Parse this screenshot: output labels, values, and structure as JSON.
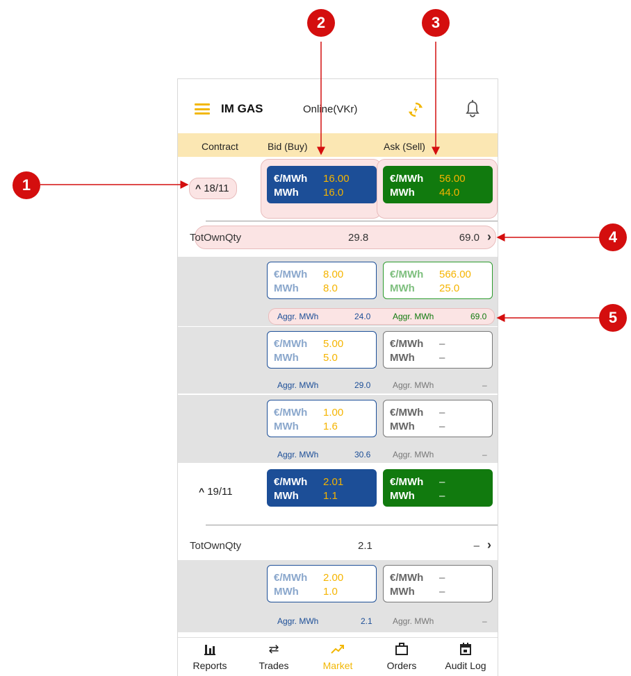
{
  "header": {
    "app_title": "IM GAS",
    "status": "Online(VKr)"
  },
  "columns": {
    "contract": "Contract",
    "bid": "Bid (Buy)",
    "ask": "Ask (Sell)"
  },
  "contracts": [
    {
      "date": "18/11",
      "best_bid": {
        "price_label": "€/MWh",
        "price": "16.00",
        "qty_label": "MWh",
        "qty": "16.0"
      },
      "best_ask": {
        "price_label": "€/MWh",
        "price": "56.00",
        "qty_label": "MWh",
        "qty": "44.0"
      },
      "tot": {
        "label": "TotOwnQty",
        "bid": "29.8",
        "ask": "69.0"
      },
      "depth": [
        {
          "bid": {
            "price_label": "€/MWh",
            "price": "8.00",
            "qty_label": "MWh",
            "qty": "8.0"
          },
          "ask": {
            "price_label": "€/MWh",
            "price": "566.00",
            "qty_label": "MWh",
            "qty": "25.0"
          },
          "aggr_label": "Aggr. MWh",
          "aggr_bid": "24.0",
          "aggr_ask": "69.0"
        },
        {
          "bid": {
            "price_label": "€/MWh",
            "price": "5.00",
            "qty_label": "MWh",
            "qty": "5.0"
          },
          "ask": {
            "price_label": "€/MWh",
            "price": "–",
            "qty_label": "MWh",
            "qty": "–"
          },
          "aggr_label": "Aggr. MWh",
          "aggr_bid": "29.0",
          "aggr_ask": "–"
        },
        {
          "bid": {
            "price_label": "€/MWh",
            "price": "1.00",
            "qty_label": "MWh",
            "qty": "1.6"
          },
          "ask": {
            "price_label": "€/MWh",
            "price": "–",
            "qty_label": "MWh",
            "qty": "–"
          },
          "aggr_label": "Aggr. MWh",
          "aggr_bid": "30.6",
          "aggr_ask": "–"
        }
      ]
    },
    {
      "date": "19/11",
      "best_bid": {
        "price_label": "€/MWh",
        "price": "2.01",
        "qty_label": "MWh",
        "qty": "1.1"
      },
      "best_ask": {
        "price_label": "€/MWh",
        "price": "–",
        "qty_label": "MWh",
        "qty": "–"
      },
      "tot": {
        "label": "TotOwnQty",
        "bid": "2.1",
        "ask": "–"
      },
      "depth": [
        {
          "bid": {
            "price_label": "€/MWh",
            "price": "2.00",
            "qty_label": "MWh",
            "qty": "1.0"
          },
          "ask": {
            "price_label": "€/MWh",
            "price": "–",
            "qty_label": "MWh",
            "qty": "–"
          },
          "aggr_label": "Aggr. MWh",
          "aggr_bid": "2.1",
          "aggr_ask": "–"
        }
      ]
    }
  ],
  "nav": [
    {
      "label": "Reports",
      "icon": "bar-chart-icon"
    },
    {
      "label": "Trades",
      "icon": "swap-icon"
    },
    {
      "label": "Market",
      "icon": "trending-up-icon",
      "active": true
    },
    {
      "label": "Orders",
      "icon": "briefcase-icon"
    },
    {
      "label": "Audit Log",
      "icon": "calendar-icon"
    }
  ],
  "callouts": [
    "1",
    "2",
    "3",
    "4",
    "5"
  ],
  "colors": {
    "accent": "#f2b705",
    "bid": "#1c4e97",
    "ask": "#117a0e",
    "callout": "#d40e0e",
    "price_text": "#f5b400"
  }
}
